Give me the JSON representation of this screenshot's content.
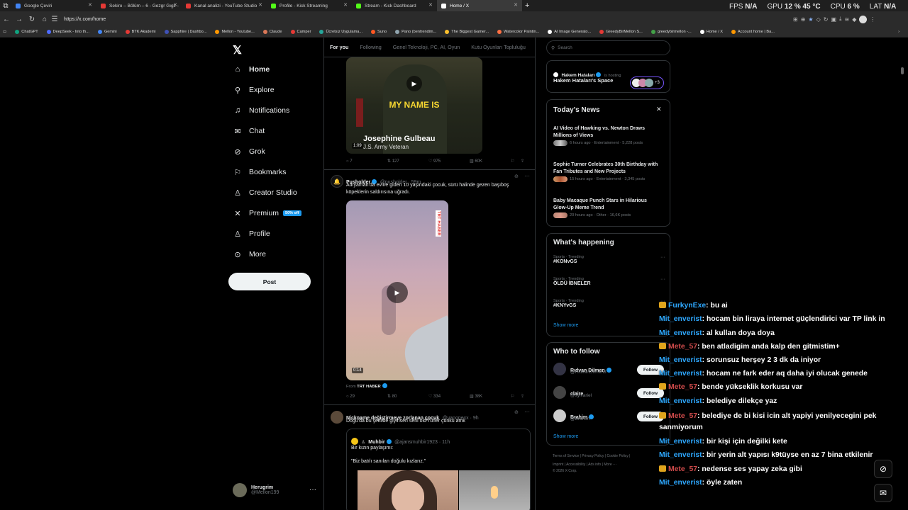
{
  "browser": {
    "tabs": [
      {
        "title": "Google Çeviri",
        "color": "#4285f4"
      },
      {
        "title": "Sekiro – Bölüm – 6 - Gezgr Gıgz -",
        "color": "#e53935"
      },
      {
        "title": "Kanal analizi - YouTube Studio",
        "color": "#e53935"
      },
      {
        "title": "Profile - Kick Streaming",
        "color": "#53fc18"
      },
      {
        "title": "Stream - Kick Dashboard",
        "color": "#53fc18"
      },
      {
        "title": "Home / X",
        "color": "#ffffff"
      }
    ],
    "url": "https://x.com/home",
    "bookmarks": [
      {
        "label": "ChatGPT",
        "color": "#10a37f"
      },
      {
        "label": "DeepSeek - Into th...",
        "color": "#4d6bfe"
      },
      {
        "label": "Gemini",
        "color": "#4285f4"
      },
      {
        "label": "BTK Akademi",
        "color": "#e53935"
      },
      {
        "label": "Sapphire | Dashbo...",
        "color": "#3f51b5"
      },
      {
        "label": "Mellon - Youtube...",
        "color": "#ff9800"
      },
      {
        "label": "Claude",
        "color": "#d97757"
      },
      {
        "label": "Camper",
        "color": "#e53935"
      },
      {
        "label": "Ücretsiz Uygulama...",
        "color": "#26a69a"
      },
      {
        "label": "Suno",
        "color": "#ff5722"
      },
      {
        "label": "Pano (bentrendim...",
        "color": "#90a4ae"
      },
      {
        "label": "The Biggest Gamer...",
        "color": "#fbc02d"
      },
      {
        "label": "Watercolor Paintin...",
        "color": "#ff7043"
      },
      {
        "label": "AI Image Generato...",
        "color": "#ffffff"
      },
      {
        "label": "GreedyBirMellon S...",
        "color": "#e53935"
      },
      {
        "label": "greedybirmellon -...",
        "color": "#43a047"
      },
      {
        "label": "Home / X",
        "color": "#ffffff"
      },
      {
        "label": "Account home | Ba...",
        "color": "#ff9800"
      }
    ]
  },
  "stats": {
    "fps_label": "FPS",
    "fps_value": "N/A",
    "gpu_label": "GPU",
    "gpu_value": "12 % 45 °C",
    "cpu_label": "CPU",
    "cpu_value": "6 %",
    "lat_label": "LAT",
    "lat_value": "N/A"
  },
  "nav": {
    "items": [
      "Home",
      "Explore",
      "Notifications",
      "Chat",
      "Grok",
      "Bookmarks",
      "Creator Studio",
      "Premium",
      "Profile",
      "More"
    ],
    "premium_badge": "50% off",
    "post_label": "Post",
    "account_name": "Herugrim",
    "account_handle": "@Mellon199"
  },
  "feed": {
    "tabs": [
      "For you",
      "Following",
      "Genel Teknoloji, PC, AI, Oyun",
      "Kutu Oyunları Topluluğu"
    ],
    "tweet1": {
      "overlay_text": "MY NAME IS",
      "caption_name": "Josephine Gulbeau",
      "caption_sub": "J.S. Army Veteran",
      "duration": "1:09",
      "replies": "7",
      "reposts": "127",
      "likes": "975",
      "views": "60K"
    },
    "tweet2": {
      "name": "Pusholder",
      "handle": "@pusholder · 59m",
      "text": "Adıyaman'da evine giden 10 yaşındaki çocuk, sürü halinde gezen başıboş köpeklerin saldırısına uğradı.",
      "watermark": "TRT HABER",
      "duration": "0:14",
      "from_label": "From",
      "from_source": "TRT HABER",
      "replies": "29",
      "reposts": "80",
      "likes": "334",
      "views": "38K"
    },
    "tweet3": {
      "name": "Nickname değiştirmeye zorlanan çocuk",
      "handle": "@vanopexx · 9h",
      "text": "Doğu'da bu şekilde giyinsen seni öld*rürler çünkü amk",
      "quote_name": "Muhbir",
      "quote_handle": "@ajansmuhbir1923 · 11h",
      "quote_text1": "Bir kızın paylaşımı:",
      "quote_text2": "\"Biz batılı sanılan doğulu kızlarız.\""
    }
  },
  "right": {
    "search_placeholder": "Search",
    "space": {
      "host": "Hakem Hataları",
      "status": "is hosting",
      "title": "Hakem Hataları's Space",
      "extra": "+3"
    },
    "news_title": "Today's News",
    "news": [
      {
        "title": "AI Video of Hawking vs. Newton Draws Millions of Views",
        "meta": "6 hours ago · Entertainment · 5,228 posts"
      },
      {
        "title": "Sophie Turner Celebrates 30th Birthday with Fan Tributes and New Projects",
        "meta": "15 hours ago · Entertainment · 3,345 posts"
      },
      {
        "title": "Baby Macaque Punch Stars in Hilarious Glow-Up Meme Trend",
        "meta": "20 hours ago · Other · 16,6K posts"
      }
    ],
    "happening_title": "What's happening",
    "trends": [
      {
        "cat": "Sports · Trending",
        "tag": "#KONvGS"
      },
      {
        "cat": "Sports · Trending",
        "tag": "ÖLDÜ İBNELER"
      },
      {
        "cat": "Sports · Trending",
        "tag": "#KNYvGS"
      }
    ],
    "show_more": "Show more",
    "wtf_title": "Who to follow",
    "follow": [
      {
        "name": "Rıdvan Dilmen",
        "handle": "@RidvanDilmen8"
      },
      {
        "name": "claire",
        "handle": "@sylvariel"
      },
      {
        "name": "Brahim",
        "handle": "@Brahim"
      }
    ],
    "follow_label": "Follow",
    "footer1": "Terms of Service  |  Privacy Policy  |  Cookie Policy  |",
    "footer2": "Imprint  |  Accessibility  |  Ads info  |  More ···",
    "footer3": "© 2026 X Corp."
  },
  "chat": [
    {
      "user": "FurkynExe",
      "text": ": bu ai",
      "style": "u1",
      "crown": true
    },
    {
      "user": "Mit_enverist",
      "text": ": hocam bin liraya internet güçlendirici var TP link in",
      "style": "u1",
      "crown": false
    },
    {
      "user": "Mit_enverist",
      "text": ": al kullan doya doya",
      "style": "u1",
      "crown": false
    },
    {
      "user": "Mete_57",
      "text": ": ben atladigim anda kalp den gitmistim+",
      "style": "u3",
      "crown": true
    },
    {
      "user": "Mit_enverist",
      "text": ": sorunsuz herşey 2 3 dk da iniyor",
      "style": "u1",
      "crown": false
    },
    {
      "user": "Mit_enverist",
      "text": ": hocam ne fark eder aq daha iyi olucak genede",
      "style": "u1",
      "crown": false
    },
    {
      "user": "Mete_57",
      "text": ": bende yükseklik korkusu var",
      "style": "u3",
      "crown": true
    },
    {
      "user": "Mit_enverist",
      "text": ": belediye dilekçe yaz",
      "style": "u1",
      "crown": false
    },
    {
      "user": "Mete_57",
      "text": ": belediye de bi kisi icin alt yapiyi yenilyecegini pek sanmiyorum",
      "style": "u3",
      "crown": true
    },
    {
      "user": "Mit_enverist",
      "text": ": bir kişi için değilki kete",
      "style": "u1",
      "crown": false
    },
    {
      "user": "Mit_enverist",
      "text": ": bir yerin alt yapısı k9tüyse en az 7 bina etkilenir",
      "style": "u1",
      "crown": false
    },
    {
      "user": "Mete_57",
      "text": ": nedense ses yapay zeka gibi",
      "style": "u3",
      "crown": true
    },
    {
      "user": "Mit_enverist",
      "text": ": öyle zaten",
      "style": "u1",
      "crown": false
    }
  ]
}
